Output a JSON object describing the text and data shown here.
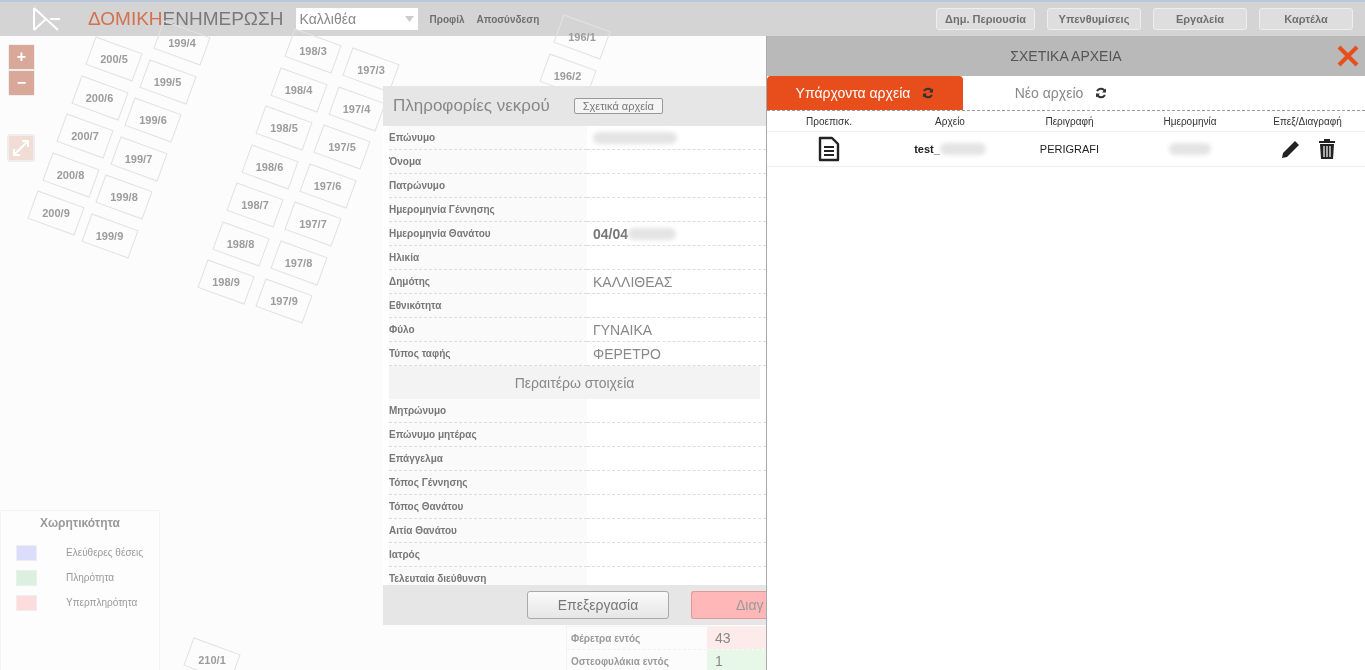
{
  "header": {
    "brand_accent": "ΔΟΜΙΚΗ",
    "brand_rest": "ΕΝΗΜΕΡΩΣΗ",
    "municipality_select": {
      "value": "Καλλιθέα"
    },
    "links": [
      "Προφίλ",
      "Αποσύνδεση"
    ],
    "buttons": [
      "Δημ. Περιουσία",
      "Υπενθυμίσεις",
      "Εργαλεία",
      "Καρτέλα"
    ]
  },
  "map": {
    "zoom_in": "+",
    "zoom_out": "−",
    "plot_columns": [
      [
        "200/5",
        "200/6",
        "200/7",
        "200/8",
        "200/9"
      ],
      [
        "199/4",
        "199/5",
        "199/6",
        "199/7",
        "199/8",
        "199/9"
      ],
      [
        "198/3",
        "198/4",
        "198/5",
        "198/6",
        "198/7",
        "198/8",
        "198/9"
      ],
      [
        "197/3",
        "197/4",
        "197/5",
        "197/6",
        "197/7",
        "197/8",
        "197/9"
      ],
      [
        "196/1",
        "196/2"
      ],
      [
        "210/1"
      ]
    ]
  },
  "legend": {
    "title": "Χωρητικότητα",
    "items": [
      {
        "label": "Ελεύθερες θέσεις",
        "color": "#dcdcfb"
      },
      {
        "label": "Πληρότητα",
        "color": "#dcf0e0"
      },
      {
        "label": "Υπερπληρότητα",
        "color": "#fcdcdc"
      }
    ]
  },
  "stats": [
    {
      "label": "Φέρετρα εντός",
      "value": "43",
      "color": "#fdeaea"
    },
    {
      "label": "Οστεοφυλάκια εντός",
      "value": "1",
      "color": "#e8f8e8"
    }
  ],
  "dialog": {
    "title": "Πληροφορίες νεκρού",
    "files_button": "Σχετικά αρχεία",
    "rows": [
      {
        "label": "Επώνυμο",
        "redacted": true
      },
      {
        "label": "Όνομα"
      },
      {
        "label": "Πατρώνυμο"
      },
      {
        "label": "Ημερομηνία Γέννησης"
      },
      {
        "label": "Ημερομηνία Θανάτου",
        "value": "04/04",
        "bold": true,
        "redacted": true
      },
      {
        "label": "Ηλικία"
      },
      {
        "label": "Δημότης",
        "value": "ΚΑΛΛΙΘΕΑΣ"
      },
      {
        "label": "Εθνικότητα"
      },
      {
        "label": "Φύλο",
        "value": "ΓΥΝΑΙΚΑ"
      },
      {
        "label": "Τύπος ταφής",
        "value": "ΦΕΡΕΤΡΟ"
      }
    ],
    "section_title": "Περαιτέρω στοιχεία",
    "more_rows": [
      {
        "label": "Μητρώνυμο"
      },
      {
        "label": "Επώνυμο μητέρας"
      },
      {
        "label": "Επάγγελμα"
      },
      {
        "label": "Τόπος Γέννησης"
      },
      {
        "label": "Τόπος Θανάτου"
      },
      {
        "label": "Αιτία Θανάτου"
      },
      {
        "label": "Ιατρός"
      },
      {
        "label": "Τελευταία διεύθυνση"
      }
    ],
    "buttons": [
      {
        "label": "Επεξεργασία",
        "kind": "edit"
      },
      {
        "label": "Διαγ",
        "kind": "delete"
      }
    ]
  },
  "files_panel": {
    "title": "ΣΧΕΤΙΚΑ ΑΡΧΕΙΑ",
    "tabs": [
      {
        "label": "Υπάρχοντα αρχεία",
        "selected": true
      },
      {
        "label": "Νέο αρχείο",
        "selected": false
      }
    ],
    "columns": [
      "Προεπισκ.",
      "Αρχείο",
      "Περιγραφή",
      "Ημερομηνία",
      "Επεξ/Διαγραφή"
    ],
    "rows": [
      {
        "file": "test_",
        "file_redacted": true,
        "description": "PERIGRAFI",
        "date_redacted": true
      }
    ]
  }
}
